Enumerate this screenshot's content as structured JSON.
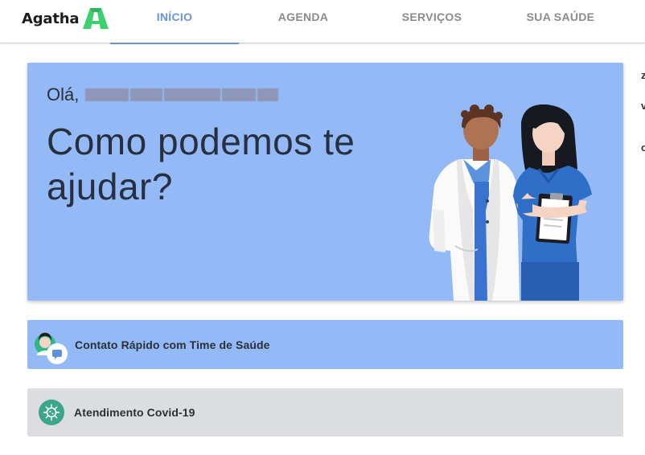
{
  "header": {
    "logo_text": "Agatha",
    "tabs": [
      {
        "label": "INÍCIO",
        "active": true
      },
      {
        "label": "AGENDA",
        "active": false
      },
      {
        "label": "SERVIÇOS",
        "active": false
      },
      {
        "label": "SUA SAÚDE",
        "active": false
      }
    ],
    "accent_color": "#6a93d6",
    "logo_color": "#3ecf6f"
  },
  "edge_fragments": [
    "z",
    "v",
    "c"
  ],
  "hero": {
    "greeting": "Olá,",
    "user_name_redacted": true,
    "headline": "Como podemos te ajudar?",
    "background_color": "#93b9f6"
  },
  "cards": {
    "quick_contact": {
      "label": "Contato Rápido com Time de Saúde",
      "icon": "chat-doctor-icon"
    },
    "covid": {
      "label": "Atendimento Covid-19",
      "icon": "virus-icon"
    }
  }
}
